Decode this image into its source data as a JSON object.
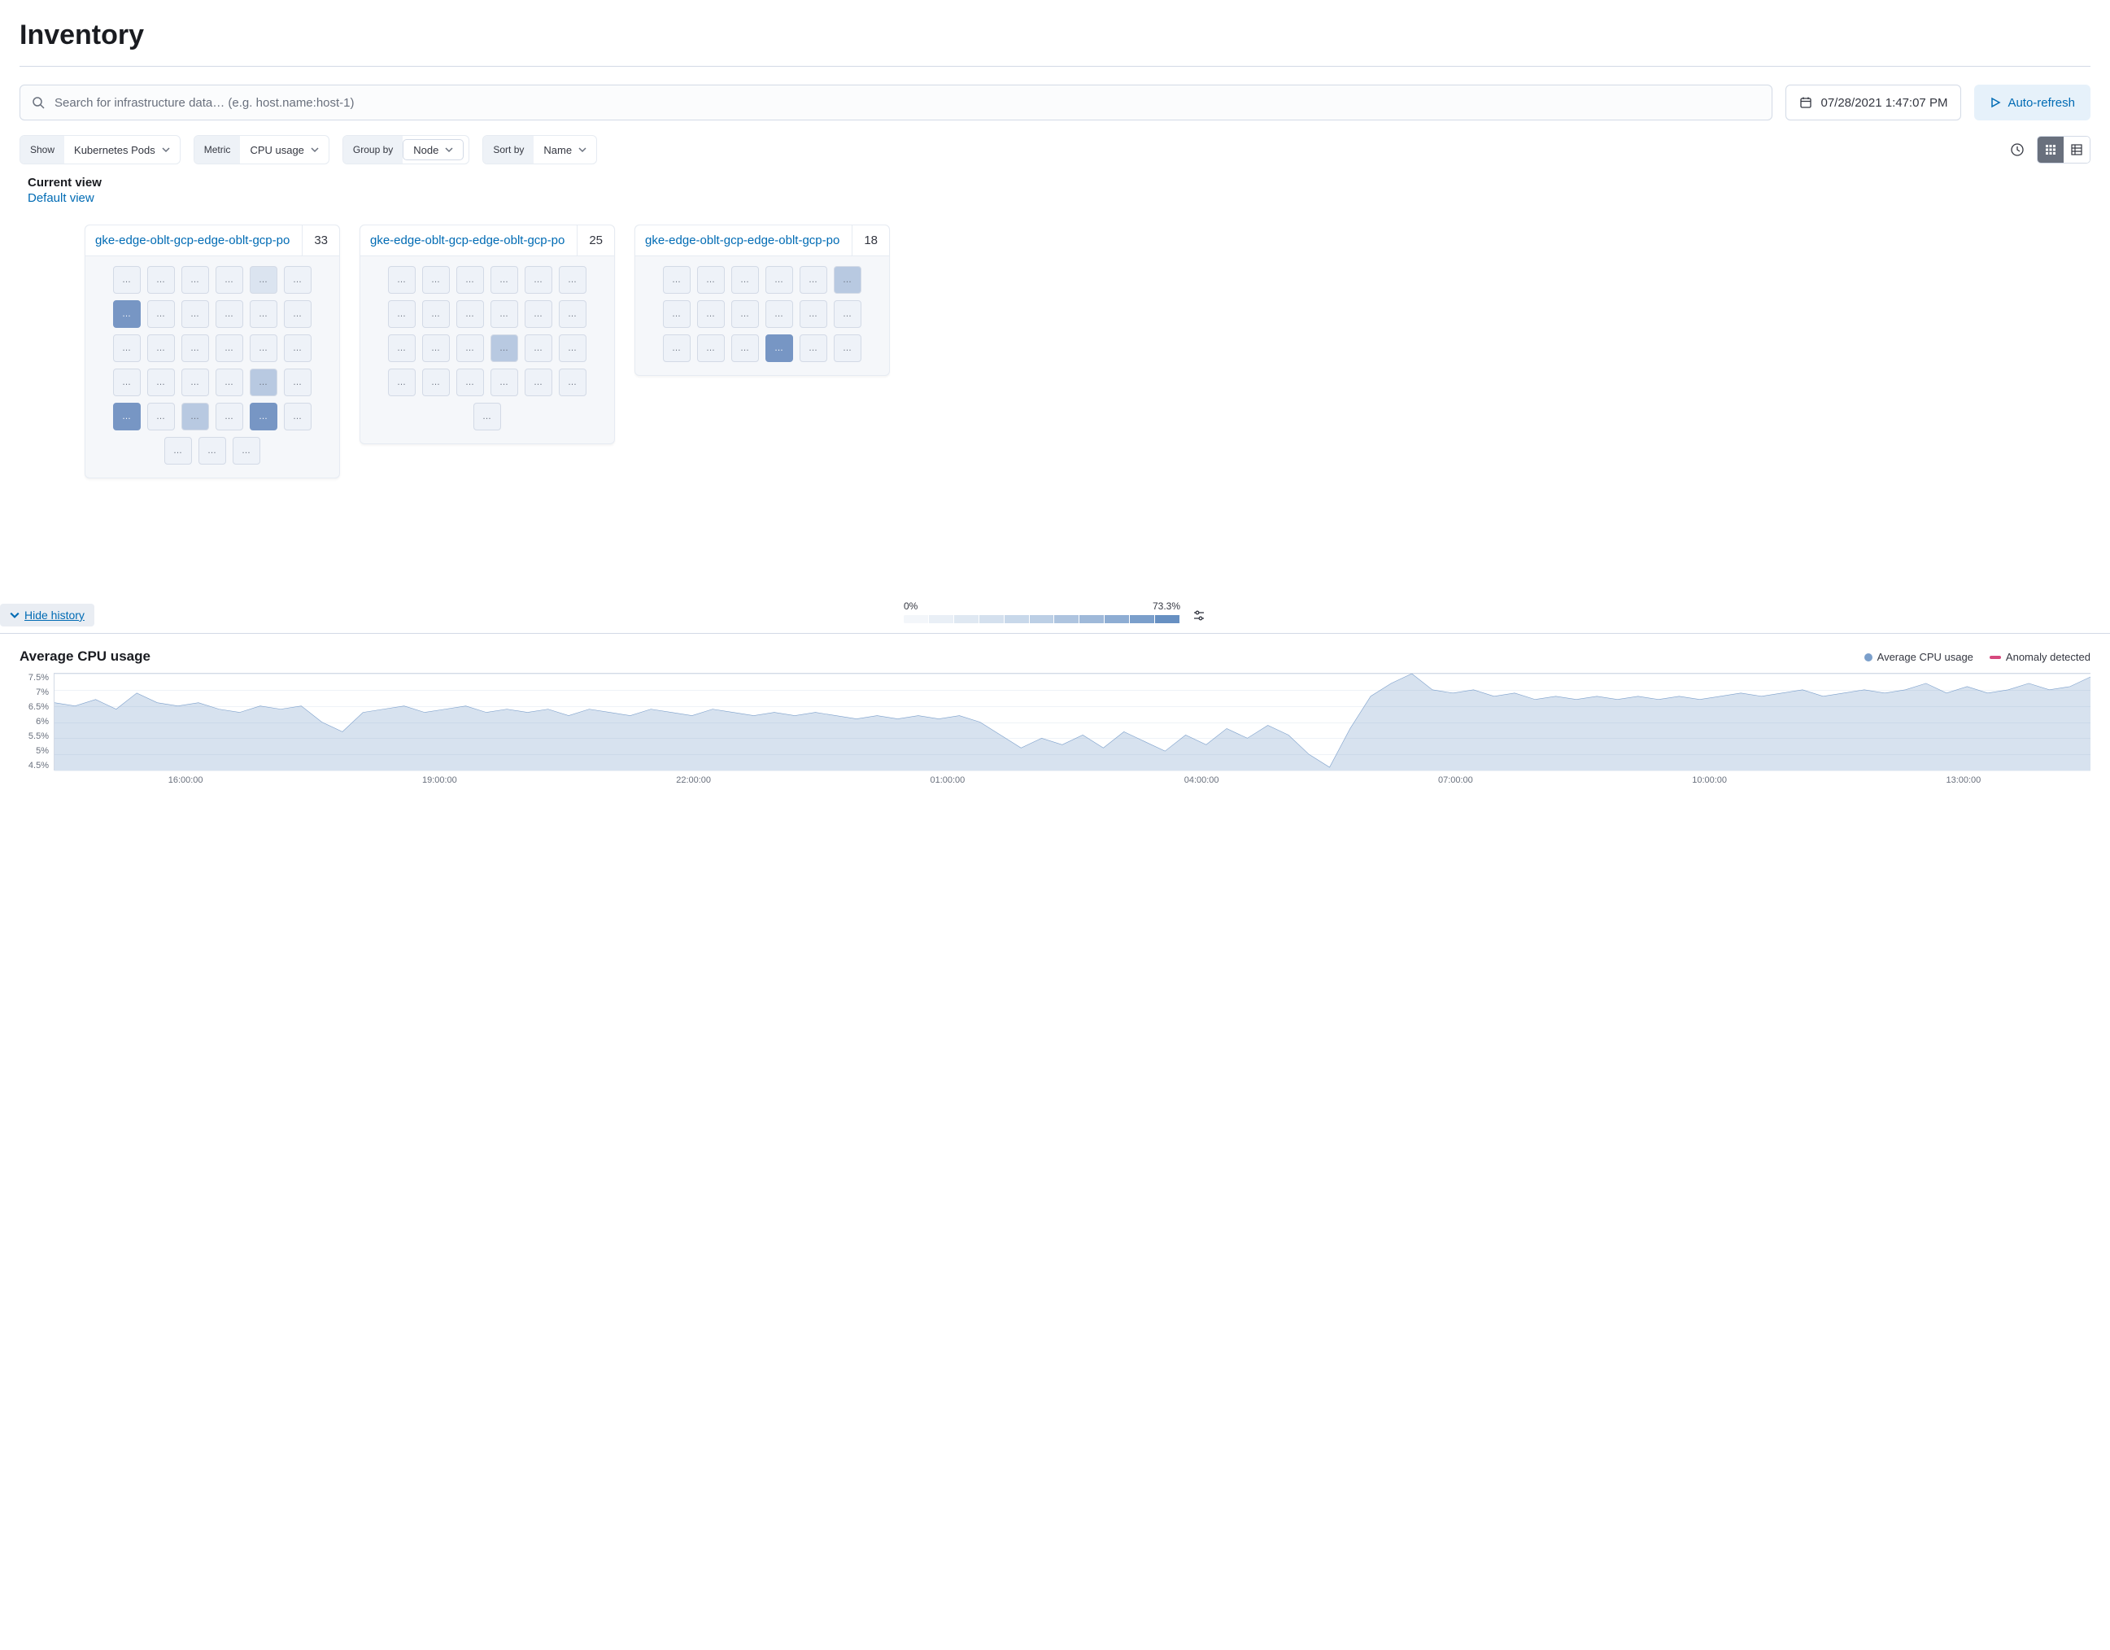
{
  "page_title": "Inventory",
  "search": {
    "placeholder": "Search for infrastructure data… (e.g. host.name:host-1)"
  },
  "date_picker": {
    "value": "07/28/2021 1:47:07 PM"
  },
  "auto_refresh": {
    "label": "Auto-refresh"
  },
  "filters": {
    "show": {
      "label": "Show",
      "value": "Kubernetes Pods"
    },
    "metric": {
      "label": "Metric",
      "value": "CPU usage"
    },
    "groupby": {
      "label": "Group by",
      "value": "Node"
    },
    "sortby": {
      "label": "Sort by",
      "value": "Name"
    }
  },
  "current_view": {
    "label": "Current view",
    "link": "Default view"
  },
  "groups": [
    {
      "title": "gke-edge-oblt-gcp-edge-oblt-gcp-po",
      "count": 33,
      "cols": 7,
      "pods": [
        0,
        0,
        0,
        0,
        1,
        0,
        3,
        0,
        0,
        0,
        0,
        0,
        0,
        0,
        0,
        0,
        0,
        0,
        0,
        0,
        0,
        0,
        2,
        0,
        3,
        0,
        2,
        0,
        3,
        0,
        0,
        0,
        0
      ]
    },
    {
      "title": "gke-edge-oblt-gcp-edge-oblt-gcp-po",
      "count": 25,
      "cols": 7,
      "pods": [
        0,
        0,
        0,
        0,
        0,
        0,
        0,
        0,
        0,
        0,
        0,
        0,
        0,
        0,
        0,
        2,
        0,
        0,
        0,
        0,
        0,
        0,
        0,
        0,
        0
      ]
    },
    {
      "title": "gke-edge-oblt-gcp-edge-oblt-gcp-po",
      "count": 18,
      "cols": 7,
      "pods": [
        0,
        0,
        0,
        0,
        0,
        2,
        0,
        0,
        0,
        0,
        0,
        0,
        0,
        0,
        0,
        3,
        0,
        0
      ]
    }
  ],
  "pod_shade_colors": [
    "#eef2f8",
    "#dbe4f0",
    "#b8c9e1",
    "#7796c4"
  ],
  "pod_label": "…",
  "legend": {
    "min": "0%",
    "max": "73.3%",
    "steps": [
      "#f3f6fa",
      "#e9eff6",
      "#dfe8f2",
      "#d4e0ee",
      "#c8d8ea",
      "#bccfe5",
      "#aec4df",
      "#9fb9d9",
      "#8eadd3",
      "#7b9fcb",
      "#6790c2"
    ]
  },
  "hide_history": {
    "label": "Hide history"
  },
  "chart_data": {
    "type": "line",
    "title": "Average CPU usage",
    "ylabel": "",
    "xlabel": "",
    "ylim": [
      4.5,
      7.5
    ],
    "y_ticks": [
      "7.5%",
      "7%",
      "6.5%",
      "6%",
      "5.5%",
      "5%",
      "4.5%"
    ],
    "x_ticks": [
      "16:00:00",
      "19:00:00",
      "22:00:00",
      "01:00:00",
      "04:00:00",
      "07:00:00",
      "10:00:00",
      "13:00:00"
    ],
    "legend": [
      {
        "name": "Average CPU usage",
        "swatch_type": "dot",
        "color": "#7b9fcb"
      },
      {
        "name": "Anomaly detected",
        "swatch_type": "bar",
        "color": "#d6487d"
      }
    ],
    "series": [
      {
        "name": "Average CPU usage",
        "color": "#7b9fcb",
        "x": [
          0,
          1,
          2,
          3,
          4,
          5,
          6,
          7,
          8,
          9,
          10,
          11,
          12,
          13,
          14,
          15,
          16,
          17,
          18,
          19,
          20,
          21,
          22,
          23,
          24,
          25,
          26,
          27,
          28,
          29,
          30,
          31,
          32,
          33,
          34,
          35,
          36,
          37,
          38,
          39,
          40,
          41,
          42,
          43,
          44,
          45,
          46,
          47,
          48,
          49,
          50,
          51,
          52,
          53,
          54,
          55,
          56,
          57,
          58,
          59,
          60,
          61,
          62,
          63,
          64,
          65,
          66,
          67,
          68,
          69,
          70,
          71,
          72,
          73,
          74,
          75,
          76,
          77,
          78,
          79,
          80,
          81,
          82,
          83,
          84,
          85,
          86,
          87,
          88,
          89,
          90,
          91,
          92,
          93,
          94,
          95,
          96,
          97,
          98,
          99
        ],
        "y": [
          6.6,
          6.5,
          6.7,
          6.4,
          6.9,
          6.6,
          6.5,
          6.6,
          6.4,
          6.3,
          6.5,
          6.4,
          6.5,
          6.0,
          5.7,
          6.3,
          6.4,
          6.5,
          6.3,
          6.4,
          6.5,
          6.3,
          6.4,
          6.3,
          6.4,
          6.2,
          6.4,
          6.3,
          6.2,
          6.4,
          6.3,
          6.2,
          6.4,
          6.3,
          6.2,
          6.3,
          6.2,
          6.3,
          6.2,
          6.1,
          6.2,
          6.1,
          6.2,
          6.1,
          6.2,
          6.0,
          5.6,
          5.2,
          5.5,
          5.3,
          5.6,
          5.2,
          5.7,
          5.4,
          5.1,
          5.6,
          5.3,
          5.8,
          5.5,
          5.9,
          5.6,
          5.0,
          4.6,
          5.8,
          6.8,
          7.2,
          7.5,
          7.0,
          6.9,
          7.0,
          6.8,
          6.9,
          6.7,
          6.8,
          6.7,
          6.8,
          6.7,
          6.8,
          6.7,
          6.8,
          6.7,
          6.8,
          6.9,
          6.8,
          6.9,
          7.0,
          6.8,
          6.9,
          7.0,
          6.9,
          7.0,
          7.2,
          6.9,
          7.1,
          6.9,
          7.0,
          7.2,
          7.0,
          7.1,
          7.4
        ]
      }
    ]
  }
}
